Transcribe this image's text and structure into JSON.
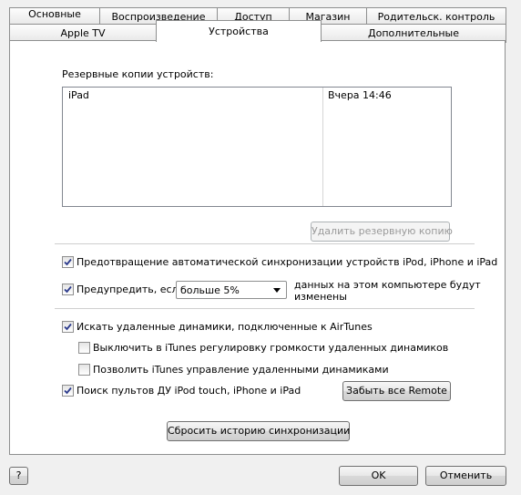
{
  "tabs_back": [
    "Основные",
    "Воспроизведение",
    "Доступ",
    "Магазин",
    "Родительск. контроль"
  ],
  "tabs_front": [
    "Apple TV",
    "Устройства",
    "Дополнительные"
  ],
  "backups": {
    "label": "Резервные копии устройств:",
    "rows": [
      {
        "device": "iPad",
        "date": "Вчера 14:46"
      }
    ],
    "delete_button": "Удалить резервную копию"
  },
  "options": {
    "prevent_sync": {
      "label": "Предотвращение автоматической синхронизации устройств iPod, iPhone и iPad",
      "checked": true
    },
    "warn": {
      "label": "Предупредить, если",
      "checked": true,
      "select_value": "больше 5%",
      "suffix_line1": "данных на этом компьютере будут",
      "suffix_line2": "изменены"
    },
    "airtunes": {
      "label": "Искать удаленные динамики, подключенные к AirTunes",
      "checked": true
    },
    "disable_volume": {
      "label": "Выключить в iTunes регулировку громкости удаленных динамиков",
      "checked": false
    },
    "allow_control": {
      "label": "Позволить iTunes управление удаленными динамиками",
      "checked": false
    },
    "remotes": {
      "label": "Поиск пультов ДУ iPod touch, iPhone и iPad",
      "checked": true,
      "forget_button": "Забыть все Remote"
    }
  },
  "reset_sync_button": "Сбросить историю синхронизации",
  "footer": {
    "help": "?",
    "ok": "OK",
    "cancel": "Отменить"
  },
  "colors": {
    "check": "#2b3a8c",
    "dialog_bg": "#f0f0f0",
    "border": "#8e8f8f"
  }
}
